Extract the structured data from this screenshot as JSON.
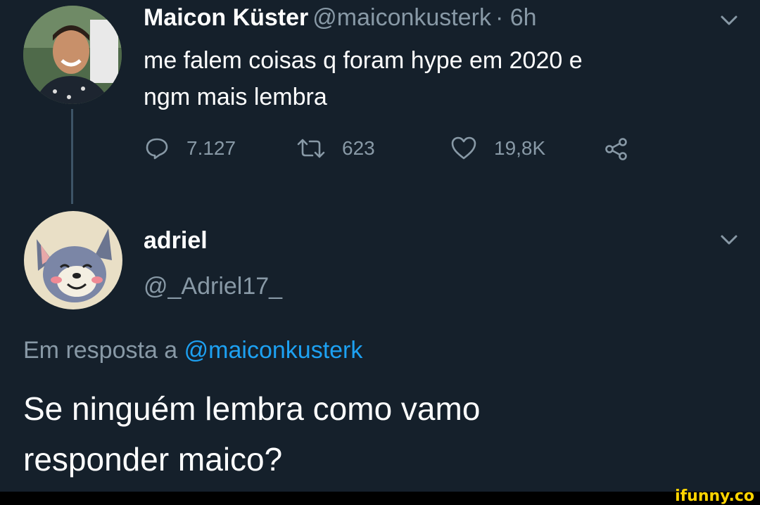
{
  "tweet": {
    "author_name": "Maicon Küster",
    "author_handle": "@maiconkusterk",
    "time": "· 6h",
    "text_line1": "me falem coisas q foram hype em 2020 e",
    "text_line2": "ngm mais lembra",
    "replies": "7.127",
    "retweets": "623",
    "likes": "19,8K",
    "icons": [
      "chevron-down-icon",
      "reply-icon",
      "retweet-icon",
      "heart-icon",
      "share-icon"
    ]
  },
  "reply": {
    "author_name": "adriel",
    "author_handle": "@_Adriel17_",
    "in_reply_prefix": "Em resposta a",
    "in_reply_handle": "@maiconkusterk",
    "text_line1": "Se ninguém lembra como vamo",
    "text_line2": "responder maico?"
  },
  "watermark": "ifunny.co",
  "colors": {
    "background": "#15202b",
    "text": "#ffffff",
    "secondary": "#8899a6",
    "link": "#1da1f2"
  }
}
